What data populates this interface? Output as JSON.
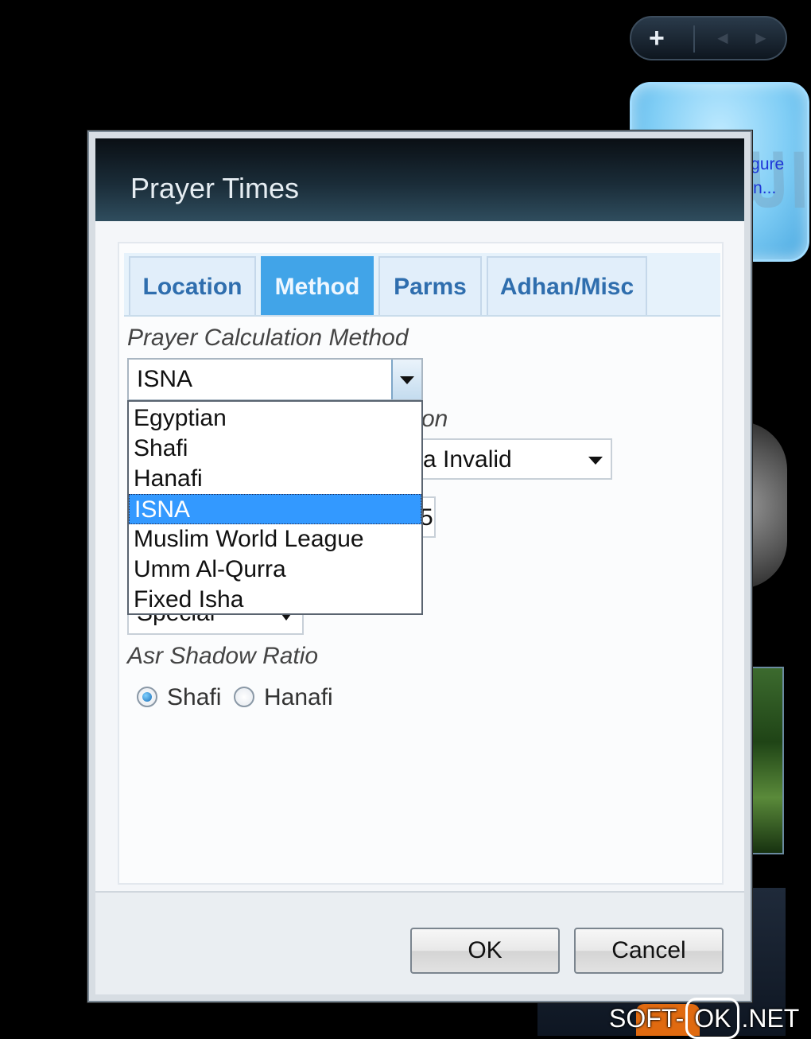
{
  "desktop": {
    "gadget_controls": {
      "add": "+",
      "prev": "◄",
      "next": "►"
    },
    "prayer_gadget": {
      "message_line1": "Please configure",
      "message_line2": "your location..."
    }
  },
  "dialog": {
    "title": "Prayer Times",
    "tabs": [
      {
        "label": "Location",
        "active": false
      },
      {
        "label": "Method",
        "active": true
      },
      {
        "label": "Parms",
        "active": false
      },
      {
        "label": "Adhan/Misc",
        "active": false
      }
    ],
    "calculation_method": {
      "label": "Prayer Calculation Method",
      "selected": "ISNA",
      "options": [
        "Egyptian",
        "Shafi",
        "Hanafi",
        "ISNA",
        "Muslim World League",
        "Umm Al-Qurra",
        "Fixed Isha"
      ],
      "highlighted_index": 3
    },
    "hidden_label_fragment": "on",
    "second_select_fragment": "a Invalid",
    "partial_value_fragment": "5",
    "third_select_fragment": "Special",
    "asr": {
      "label": "Asr Shadow Ratio",
      "options": [
        {
          "label": "Shafi",
          "checked": true
        },
        {
          "label": "Hanafi",
          "checked": false
        }
      ]
    },
    "buttons": {
      "ok": "OK",
      "cancel": "Cancel"
    }
  },
  "watermark": {
    "left": "SOFT-",
    "box": "OK",
    "right": ".NET"
  },
  "colors": {
    "tab_active": "#41a4e8",
    "selection": "#3399ff",
    "gadget_text": "#1d36d8"
  }
}
